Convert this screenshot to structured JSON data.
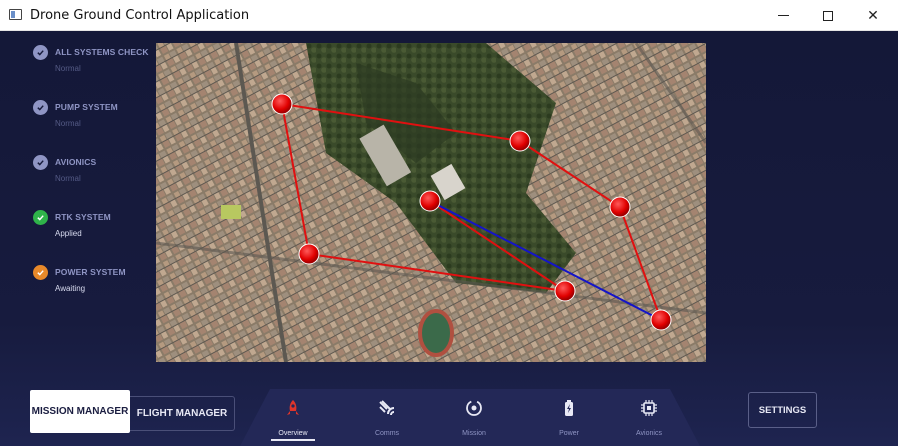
{
  "window": {
    "title": "Drone Ground Control Application",
    "minimize": "minimize",
    "maximize": "maximize",
    "close": "✕"
  },
  "checklist": [
    {
      "title": "ALL SYSTEMS CHECK",
      "status": "Normal",
      "state": "neutral"
    },
    {
      "title": "PUMP SYSTEM",
      "status": "Normal",
      "state": "neutral"
    },
    {
      "title": "AVIONICS",
      "status": "Normal",
      "state": "neutral"
    },
    {
      "title": "RTK SYSTEM",
      "status": "Applied",
      "state": "ok"
    },
    {
      "title": "POWER SYSTEM",
      "status": "Awaiting",
      "state": "warning"
    }
  ],
  "colors": {
    "neutral": "#8f95c4",
    "ok": "#2fb34a",
    "warning": "#e8892a",
    "route_red": "#e01010",
    "route_blue": "#1414c8",
    "accent_red": "#e0352b"
  },
  "buttons": {
    "mission_manager": "MISSION MANAGER",
    "flight_manager": "FLIGHT MANAGER",
    "settings": "SETTINGS"
  },
  "nav": [
    {
      "label": "Overview",
      "icon": "rocket-icon",
      "active": true
    },
    {
      "label": "Comms",
      "icon": "signal-icon",
      "active": false
    },
    {
      "label": "Mission",
      "icon": "target-icon",
      "active": false
    },
    {
      "label": "Power",
      "icon": "battery-icon",
      "active": false
    },
    {
      "label": "Avionics",
      "icon": "chip-icon",
      "active": false
    }
  ]
}
